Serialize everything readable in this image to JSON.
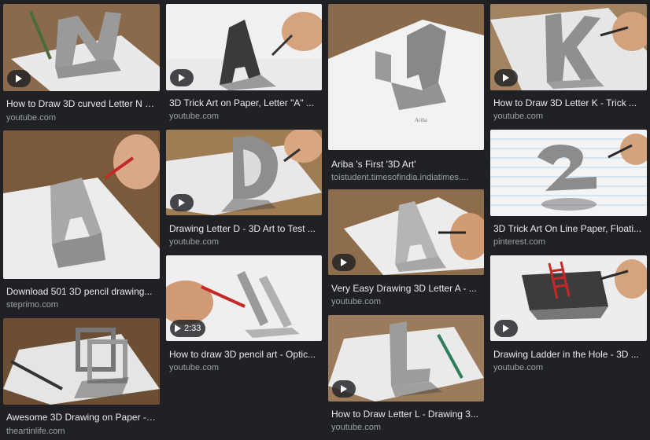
{
  "results": [
    {
      "title": "How to Draw 3D curved Letter N - ...",
      "source": "youtube.com",
      "video": true,
      "duration": ""
    },
    {
      "title": "Download 501 3D pencil drawing...",
      "source": "steprimo.com",
      "video": false,
      "duration": ""
    },
    {
      "title": "Awesome 3D Drawing on Paper - ...",
      "source": "theartinlife.com",
      "video": false,
      "duration": ""
    },
    {
      "title": "3D Trick Art on Paper, Letter \"A\" ...",
      "source": "youtube.com",
      "video": true,
      "duration": ""
    },
    {
      "title": "Drawing Letter D - 3D Art to Test ...",
      "source": "youtube.com",
      "video": true,
      "duration": ""
    },
    {
      "title": "How to draw 3D pencil art - Optic...",
      "source": "youtube.com",
      "video": true,
      "duration": "2:33"
    },
    {
      "title": "Ariba 's First '3D Art'",
      "source": "toistudent.timesofindia.indiatimes....",
      "video": false,
      "duration": ""
    },
    {
      "title": "Very Easy Drawing 3D Letter A - ...",
      "source": "youtube.com",
      "video": true,
      "duration": ""
    },
    {
      "title": "How to Draw Letter L - Drawing 3...",
      "source": "youtube.com",
      "video": true,
      "duration": ""
    },
    {
      "title": "How to Draw 3D Letter K - Trick ...",
      "source": "youtube.com",
      "video": true,
      "duration": ""
    },
    {
      "title": "3D Trick Art On Line Paper, Floati...",
      "source": "pinterest.com",
      "video": false,
      "duration": ""
    },
    {
      "title": "Drawing Ladder in the Hole - 3D ...",
      "source": "youtube.com",
      "video": true,
      "duration": ""
    }
  ]
}
